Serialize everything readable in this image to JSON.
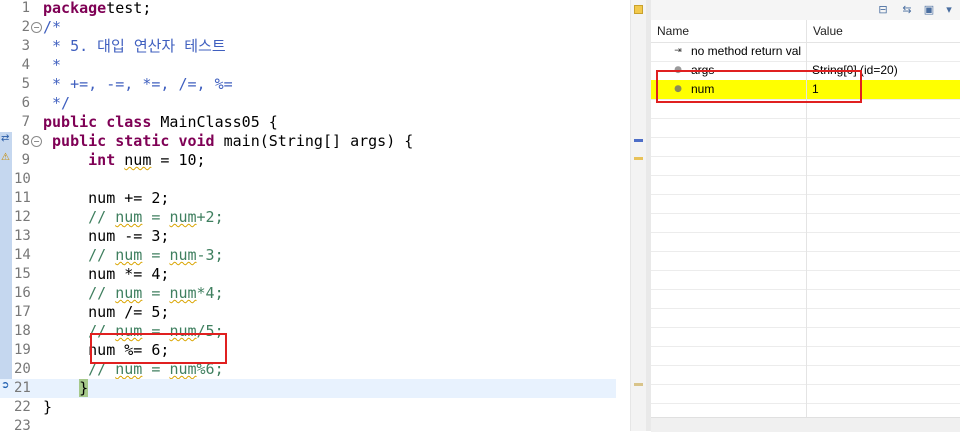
{
  "editor": {
    "lines": [
      {
        "n": "1",
        "t": [
          [
            "kw",
            "package"
          ],
          [
            "",
            "test;"
          ]
        ]
      },
      {
        "n": "2",
        "t": [
          [
            "jd",
            "/*"
          ]
        ]
      },
      {
        "n": "3",
        "t": [
          [
            "jd",
            " * 5. 대입 연산자 테스트"
          ]
        ]
      },
      {
        "n": "4",
        "t": [
          [
            "jd",
            " *"
          ]
        ]
      },
      {
        "n": "5",
        "t": [
          [
            "jd",
            " * +=, -=, *=, /=, %="
          ]
        ]
      },
      {
        "n": "6",
        "t": [
          [
            "jd",
            " */"
          ]
        ]
      },
      {
        "n": "7",
        "t": [
          [
            "kw",
            "public class"
          ],
          [
            "",
            " MainClass05 {"
          ]
        ]
      },
      {
        "n": "8",
        "t": [
          [
            "",
            " "
          ],
          [
            "kw",
            "public static void"
          ],
          [
            "",
            " main(String[] "
          ],
          [
            "var",
            "args"
          ],
          [
            "",
            ") {"
          ]
        ]
      },
      {
        "n": "9",
        "t": [
          [
            "",
            "     "
          ],
          [
            "kw",
            "int"
          ],
          [
            "",
            ""
          ],
          [
            "warn",
            "num"
          ],
          [
            "",
            " = 10;"
          ]
        ]
      },
      {
        "n": "10",
        "t": [
          [
            "",
            ""
          ]
        ]
      },
      {
        "n": "11",
        "t": [
          [
            "",
            "     num += 2;"
          ]
        ]
      },
      {
        "n": "12",
        "t": [
          [
            "",
            "     "
          ],
          [
            "cm",
            "// "
          ],
          [
            "cmw",
            "num"
          ],
          [
            "cm",
            " = "
          ],
          [
            "cmw",
            "num"
          ],
          [
            "cm",
            "+2;"
          ]
        ]
      },
      {
        "n": "13",
        "t": [
          [
            "",
            "     num -= 3;"
          ]
        ]
      },
      {
        "n": "14",
        "t": [
          [
            "",
            "     "
          ],
          [
            "cm",
            "// "
          ],
          [
            "cmw",
            "num"
          ],
          [
            "cm",
            " = "
          ],
          [
            "cmw",
            "num"
          ],
          [
            "cm",
            "-3;"
          ]
        ]
      },
      {
        "n": "15",
        "t": [
          [
            "",
            "     num *= 4;"
          ]
        ]
      },
      {
        "n": "16",
        "t": [
          [
            "",
            "     "
          ],
          [
            "cm",
            "// "
          ],
          [
            "cmw",
            "num"
          ],
          [
            "cm",
            " = "
          ],
          [
            "cmw",
            "num"
          ],
          [
            "cm",
            "*4;"
          ]
        ]
      },
      {
        "n": "17",
        "t": [
          [
            "",
            "     num /= 5;"
          ]
        ]
      },
      {
        "n": "18",
        "t": [
          [
            "",
            "     "
          ],
          [
            "cm",
            "// "
          ],
          [
            "cmw",
            "num"
          ],
          [
            "cm",
            " = "
          ],
          [
            "cmw",
            "num"
          ],
          [
            "cm",
            "/5;"
          ]
        ]
      },
      {
        "n": "19",
        "t": [
          [
            "",
            "     num %= 6;"
          ]
        ]
      },
      {
        "n": "20",
        "t": [
          [
            "",
            "     "
          ],
          [
            "cm",
            "// "
          ],
          [
            "cmw",
            "num"
          ],
          [
            "cm",
            " = "
          ],
          [
            "cmw",
            "num"
          ],
          [
            "cm",
            "%6;"
          ]
        ]
      },
      {
        "n": "21",
        "t": [
          [
            "",
            "    "
          ],
          [
            "brace",
            "}"
          ]
        ]
      },
      {
        "n": "22",
        "t": [
          [
            "",
            "}"
          ]
        ]
      },
      {
        "n": "23",
        "t": [
          [
            "",
            ""
          ]
        ]
      }
    ]
  },
  "variables": {
    "columns": {
      "name": "Name",
      "value": "Value"
    },
    "rows": [
      {
        "icon": "return-value-icon",
        "name": "no method return val",
        "value": ""
      },
      {
        "icon": "local-variable-icon",
        "name": "args",
        "value": "String[0]  (id=20)"
      },
      {
        "icon": "local-variable-icon",
        "name": "num",
        "value": "1"
      }
    ]
  },
  "colors": {
    "keyword": "#7f0055",
    "comment": "#3f7f5f",
    "javadoc": "#3f5fbf",
    "highlight_row": "#ffff00",
    "annotation_box": "#e02020"
  }
}
